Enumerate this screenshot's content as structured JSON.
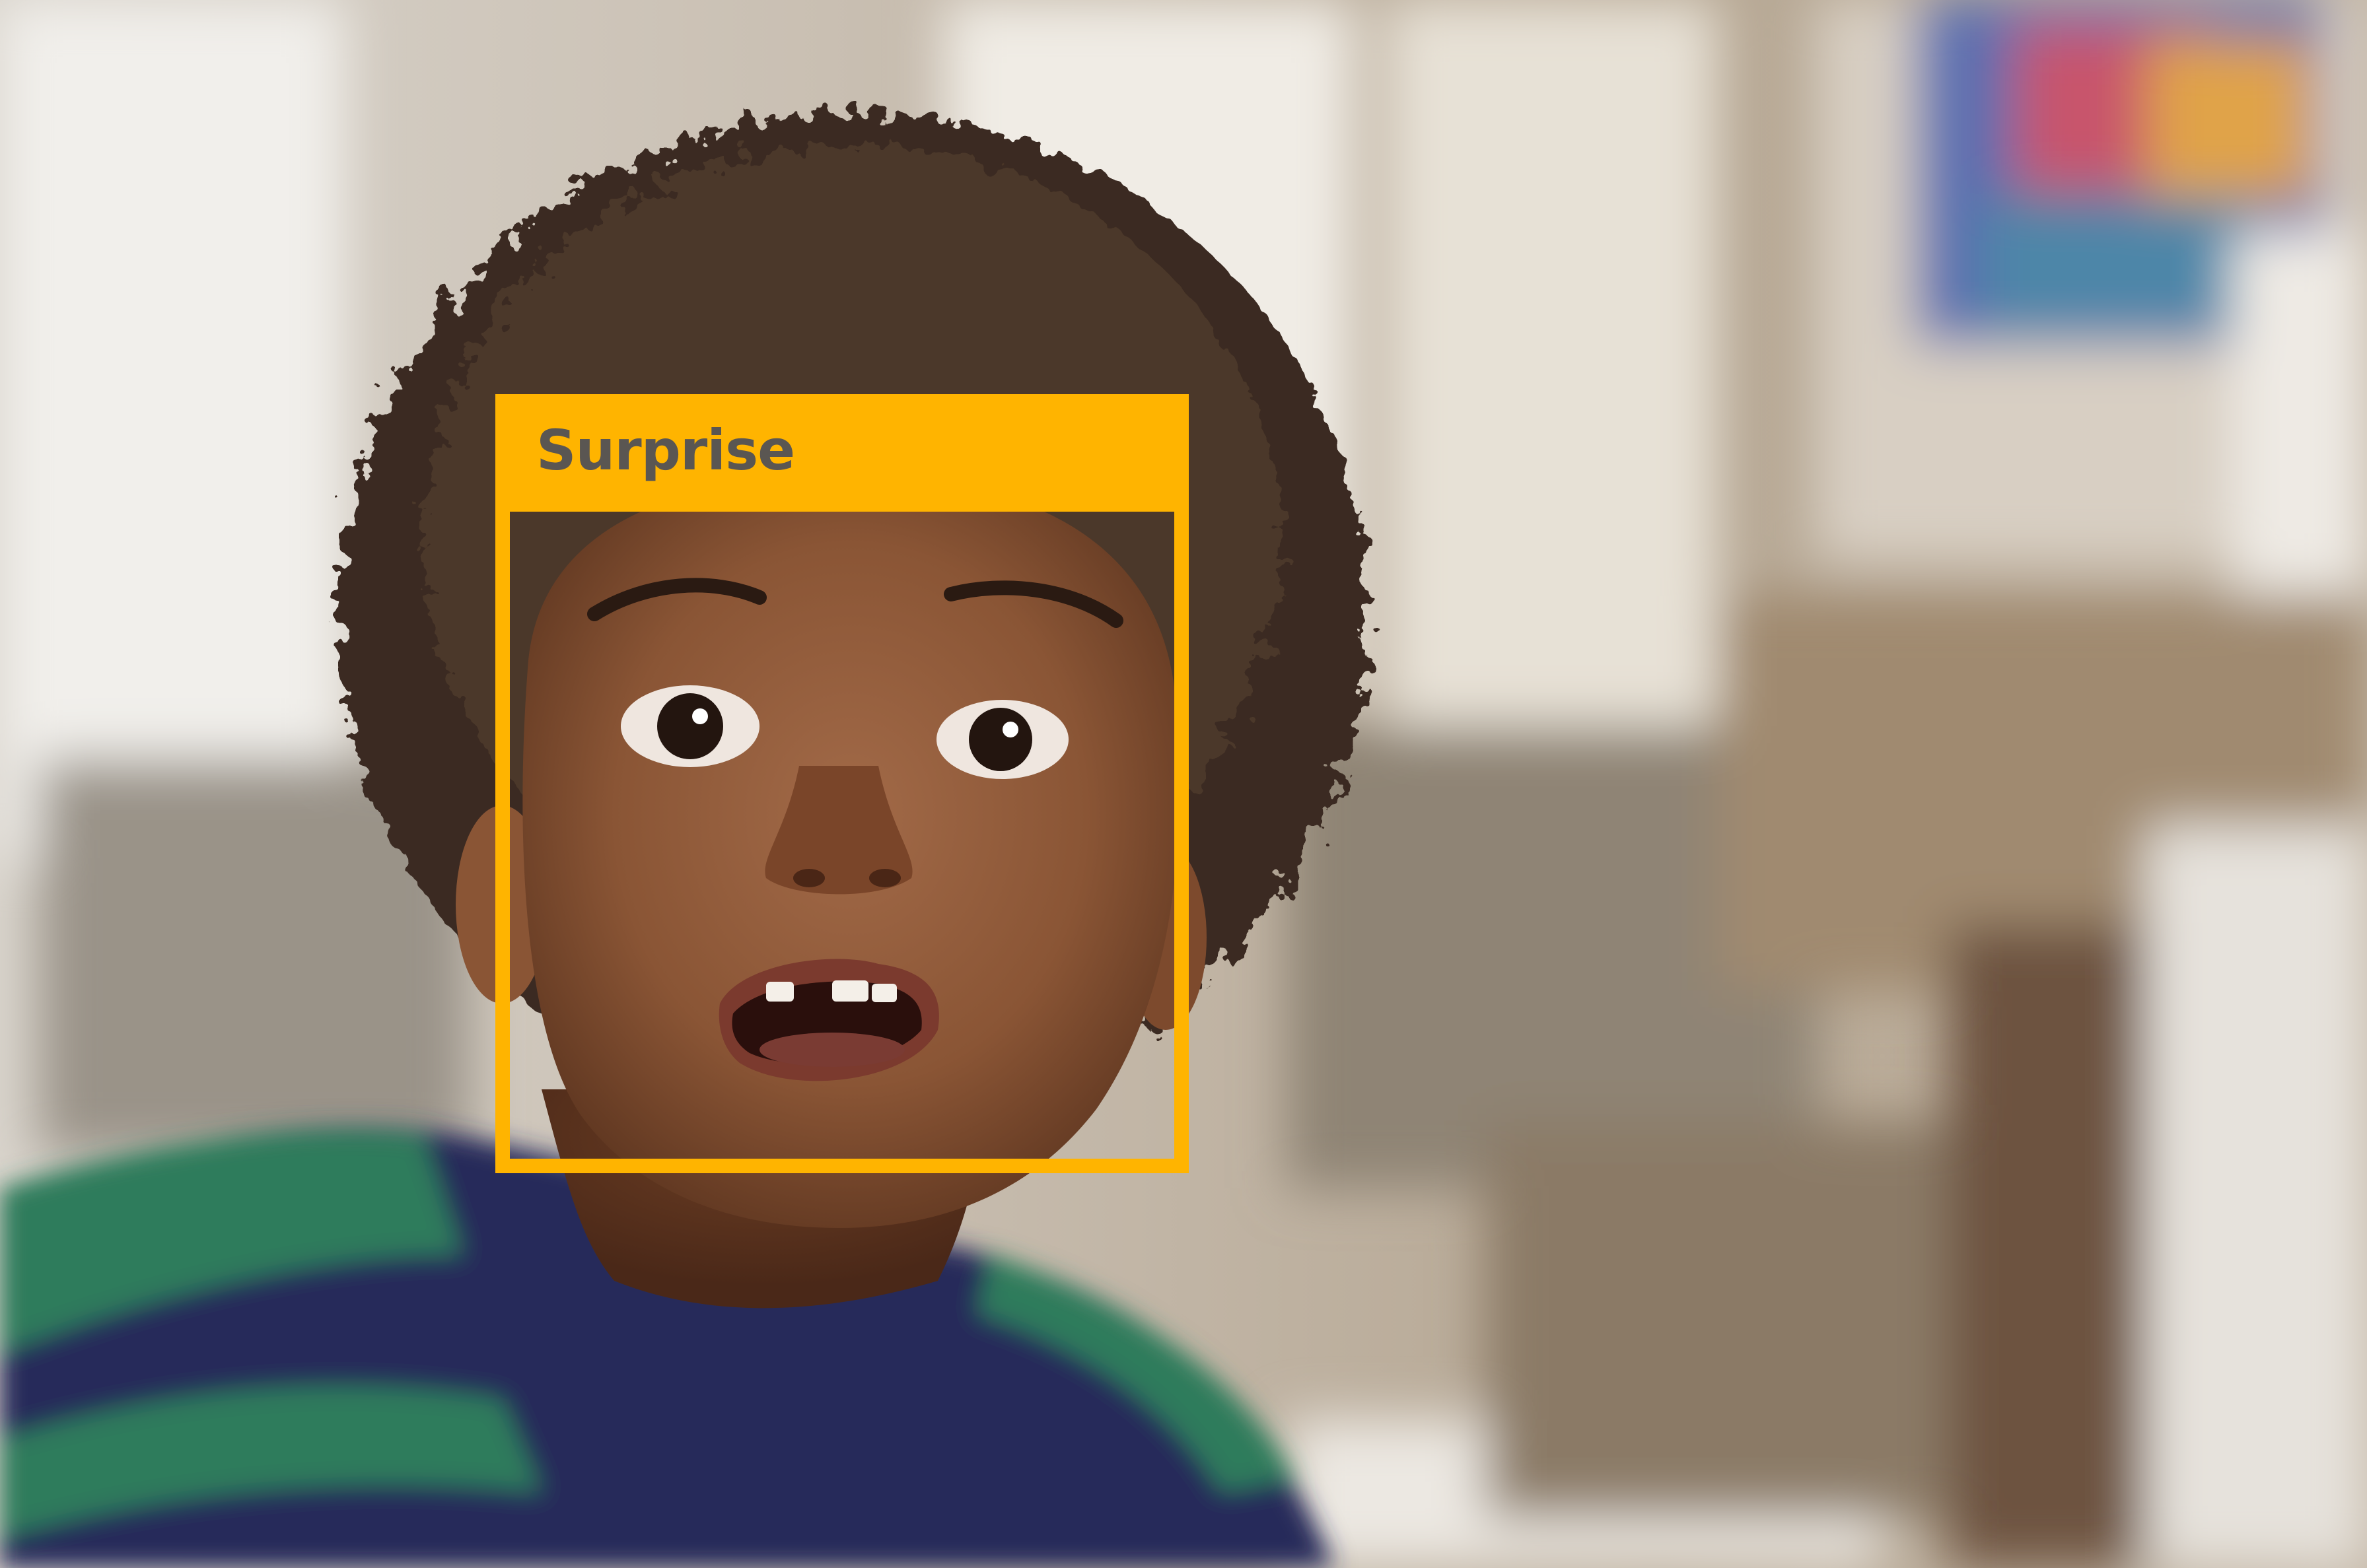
{
  "detection": {
    "emotion_label": "Surprise",
    "box_color": "#ffb400",
    "label_text_color": "#5a5652"
  }
}
